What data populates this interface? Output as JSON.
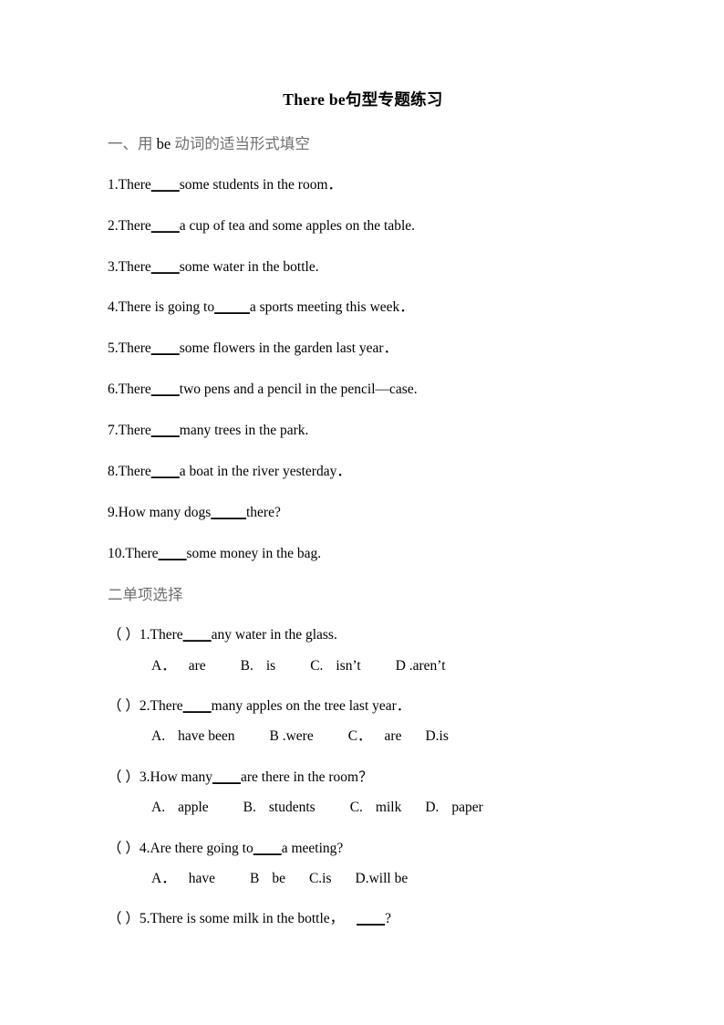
{
  "document": {
    "title": "There be 句型专题练习",
    "title_plain": "There be句型专题练习"
  },
  "sections": [
    {
      "heading_prefix": "一、用 ",
      "heading_latin": "be",
      "heading_suffix": " 动词的适当形式填空",
      "heading_full": "一、用 be 动词的适当形式填空",
      "questions": [
        {
          "number": "1.",
          "before": "There",
          "blank": "____",
          "after": "some students in the room．"
        },
        {
          "number": "2.",
          "before": "There",
          "blank": "____",
          "after": "a cup of tea and some apples on the table."
        },
        {
          "number": "3.",
          "before": "There",
          "blank": "____",
          "after": "some water in the bottle."
        },
        {
          "number": "4.",
          "before": "There is going to",
          "blank": "_____",
          "after": "a sports meeting this week．"
        },
        {
          "number": "5.",
          "before": "There",
          "blank": "____",
          "after": "some flowers in the garden last year．"
        },
        {
          "number": "6.",
          "before": "There",
          "blank": "____",
          "after": "two pens and a pencil in the pencil—case."
        },
        {
          "number": "7.",
          "before": "There",
          "blank": "____",
          "after": "many trees in the park."
        },
        {
          "number": "8.",
          "before": "There",
          "blank": "____",
          "after": "a boat in the river yesterday．"
        },
        {
          "number": "9.",
          "before": "How many dogs",
          "blank": "_____",
          "after": "there?"
        },
        {
          "number": "10.",
          "before": "There",
          "blank": "____",
          "after": "some money in the bag."
        }
      ]
    },
    {
      "heading_full": "二单项选择",
      "questions": [
        {
          "bracket": "（   ）",
          "number": "1.",
          "before": "There",
          "blank": "____",
          "after": "any water in the glass.",
          "options": [
            {
              "label": "A．",
              "text": "are"
            },
            {
              "label": "B.",
              "text": "is"
            },
            {
              "label": "C.",
              "text": "isn’t"
            },
            {
              "label": "D .",
              "text": "aren’t"
            }
          ]
        },
        {
          "bracket": "（   ）",
          "number": "2.",
          "before": "There",
          "blank": "____",
          "after": "many apples on the tree last year．",
          "options": [
            {
              "label": "A.",
              "text": "have been"
            },
            {
              "label": "B .",
              "text": "were"
            },
            {
              "label": "C．",
              "text": "are"
            },
            {
              "label": "D.",
              "text": "is"
            }
          ]
        },
        {
          "bracket": "（   ）",
          "number": "3.",
          "before": "How many",
          "blank": "____",
          "after": "are there in the room？",
          "options": [
            {
              "label": "A.",
              "text": "apple"
            },
            {
              "label": "B.",
              "text": "students"
            },
            {
              "label": "C.",
              "text": "milk"
            },
            {
              "label": "D.",
              "text": "paper"
            }
          ]
        },
        {
          "bracket": "（   ）",
          "number": "4.",
          "before": "Are there going to",
          "blank": "____",
          "after": "a meeting?",
          "options": [
            {
              "label": "A．",
              "text": "have"
            },
            {
              "label": "B",
              "text": "be"
            },
            {
              "label": "C.",
              "text": "is"
            },
            {
              "label": "D.",
              "text": "will be"
            }
          ]
        },
        {
          "bracket": "（   ）",
          "number": "5.",
          "before": "There is some milk in the bottle，",
          "blank": "____",
          "after": "?",
          "options": []
        }
      ]
    }
  ],
  "colors": {
    "text": "#000000",
    "heading": "#6f6f6f",
    "background": "#ffffff"
  }
}
